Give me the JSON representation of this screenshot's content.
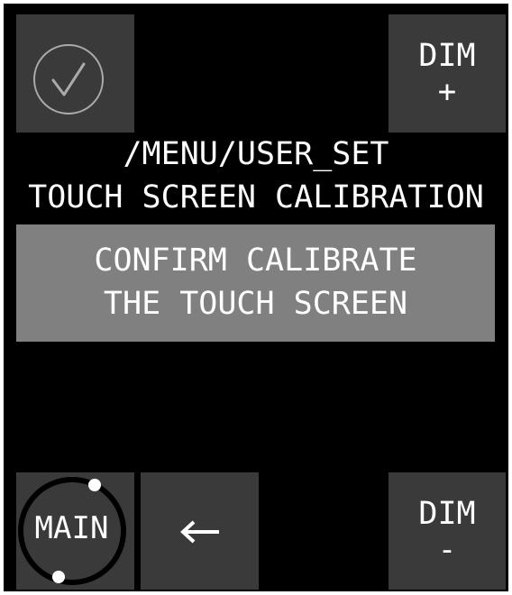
{
  "header": {
    "path": "/MENU/USER_SET",
    "title": "TOUCH SCREEN CALIBRATION"
  },
  "confirm_tile": {
    "icon": "check-circle-icon"
  },
  "dim_plus": {
    "line1": "DIM",
    "line2": "+"
  },
  "banner": {
    "line1": "CONFIRM CALIBRATE",
    "line2": "THE TOUCH SCREEN"
  },
  "main_button": {
    "label": "MAIN"
  },
  "back_button": {
    "icon": "left-arrow-icon",
    "glyph": "←"
  },
  "dim_minus": {
    "line1": "DIM",
    "line2": "-"
  },
  "colors": {
    "screen_bg": "#000000",
    "tile_bg": "#3a3a3a",
    "banner_bg": "#808080",
    "text": "#ffffff",
    "icon_outline": "#aaaaaa"
  }
}
